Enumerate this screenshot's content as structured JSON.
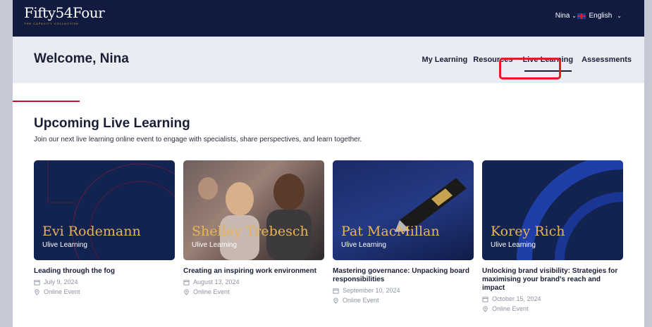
{
  "header": {
    "logo_text": "Fifty54Four",
    "logo_tagline": "THE CAPACITY COLLECTIVE",
    "user_menu": "Nina",
    "language": "English"
  },
  "subheader": {
    "welcome": "Welcome, Nina",
    "nav": [
      "My Learning",
      "Resources",
      "Live Learning",
      "Assessments"
    ]
  },
  "section": {
    "title": "Upcoming Live Learning",
    "subtitle": "Join our next live learning online event to engage with specialists, share perspectives, and learn together."
  },
  "cards": [
    {
      "speaker": "Evi Rodemann",
      "brand": "Ulive Learning",
      "title": "Leading through the fog",
      "date": "July 9, 2024",
      "location": "Online Event"
    },
    {
      "speaker": "Shelley Trebesch",
      "brand": "Ulive Learning",
      "title": "Creating an inspiring work environment",
      "date": "August 13, 2024",
      "location": "Online Event"
    },
    {
      "speaker": "Pat MacMillan",
      "brand": "Ulive Learning",
      "title": "Mastering governance: Unpacking board responsibilities",
      "date": "September 10, 2024",
      "location": "Online Event"
    },
    {
      "speaker": "Korey Rich",
      "brand": "Ulive Learning",
      "title": "Unlocking brand visibility: Strategies for maximising your brand's reach and impact",
      "date": "October 15, 2024",
      "location": "Online Event"
    }
  ],
  "colors": {
    "navy": "#111b3f",
    "gold": "#e7b455",
    "accent_red": "#e31b23"
  }
}
